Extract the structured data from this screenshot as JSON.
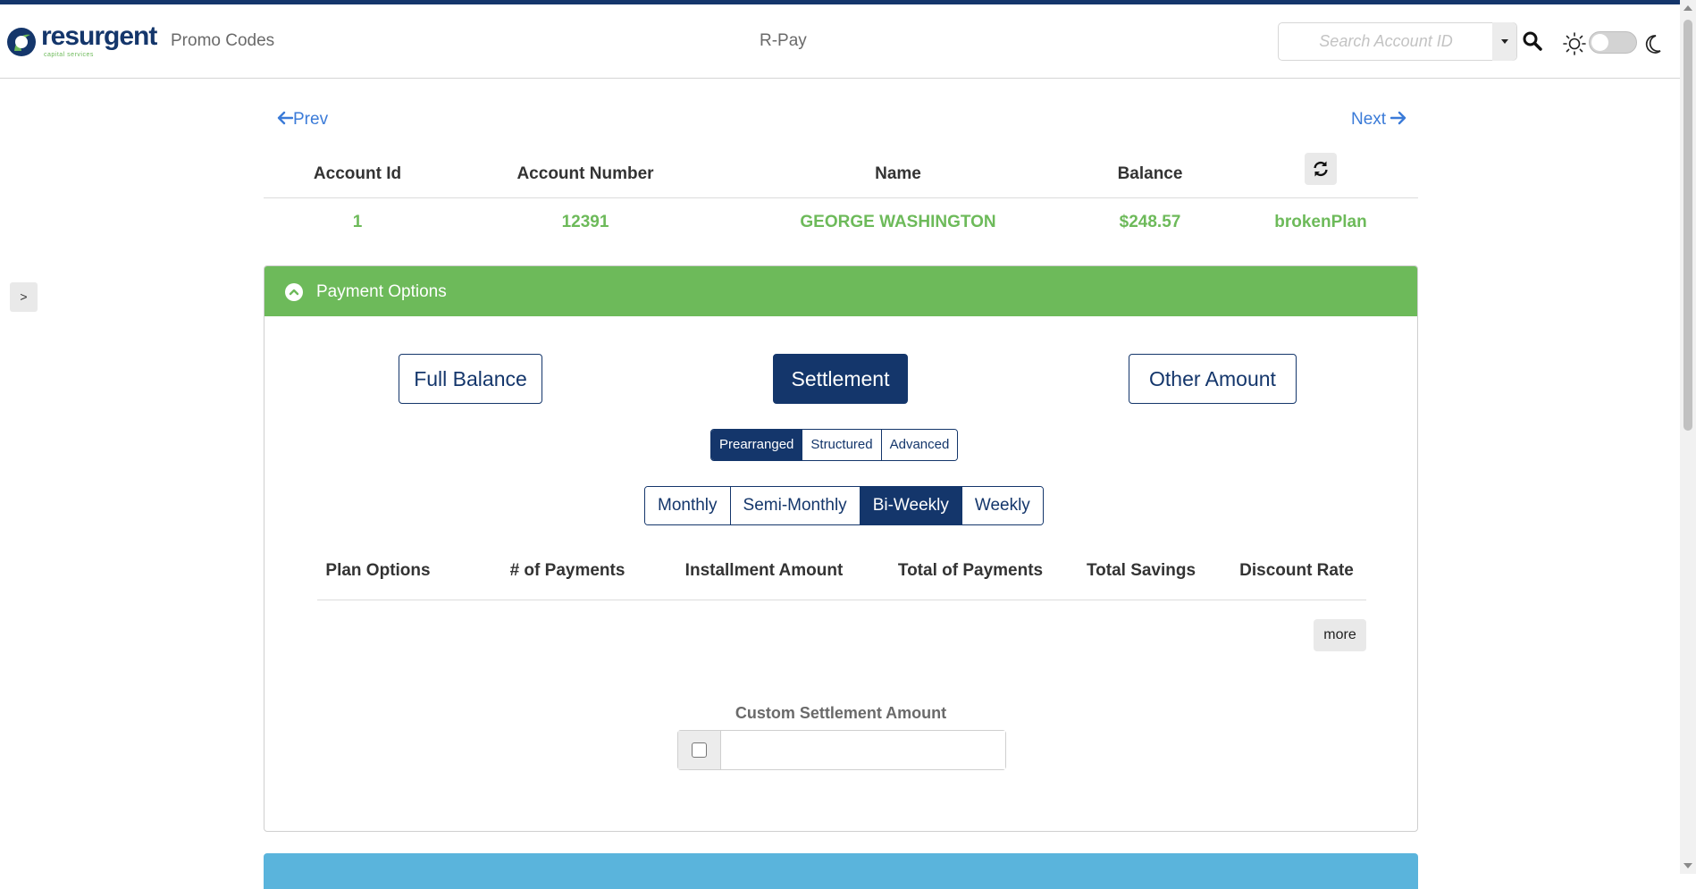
{
  "header": {
    "brand_name": "resurgent",
    "brand_sub": "capital services",
    "nav_promo": "Promo Codes",
    "nav_center": "R-Pay",
    "search_placeholder": "Search Account ID"
  },
  "sidebar_toggle_label": ">",
  "pager": {
    "prev_label": "Prev",
    "next_label": "Next"
  },
  "account_table": {
    "columns": [
      "Account Id",
      "Account Number",
      "Name",
      "Balance"
    ],
    "row": {
      "account_id": "1",
      "account_number": "12391",
      "name": "GEORGE WASHINGTON",
      "balance": "$248.57",
      "plan_status": "brokenPlan"
    }
  },
  "payment_options": {
    "title": "Payment Options",
    "amount_buttons": [
      "Full Balance",
      "Settlement",
      "Other Amount"
    ],
    "selected_amount": "Settlement",
    "plan_types": [
      "Prearranged",
      "Structured",
      "Advanced"
    ],
    "selected_plan_type": "Prearranged",
    "frequencies": [
      "Monthly",
      "Semi-Monthly",
      "Bi-Weekly",
      "Weekly"
    ],
    "selected_frequency": "Bi-Weekly",
    "plan_columns": [
      "Plan Options",
      "# of Payments",
      "Installment Amount",
      "Total of Payments",
      "Total Savings",
      "Discount Rate"
    ],
    "more_label": "more",
    "custom_settlement_label": "Custom Settlement Amount",
    "custom_settlement_value": ""
  },
  "colors": {
    "navy": "#14366b",
    "green": "#6dba5a",
    "link_blue": "#3b7bd8",
    "light_blue_panel": "#5ab4dc"
  }
}
